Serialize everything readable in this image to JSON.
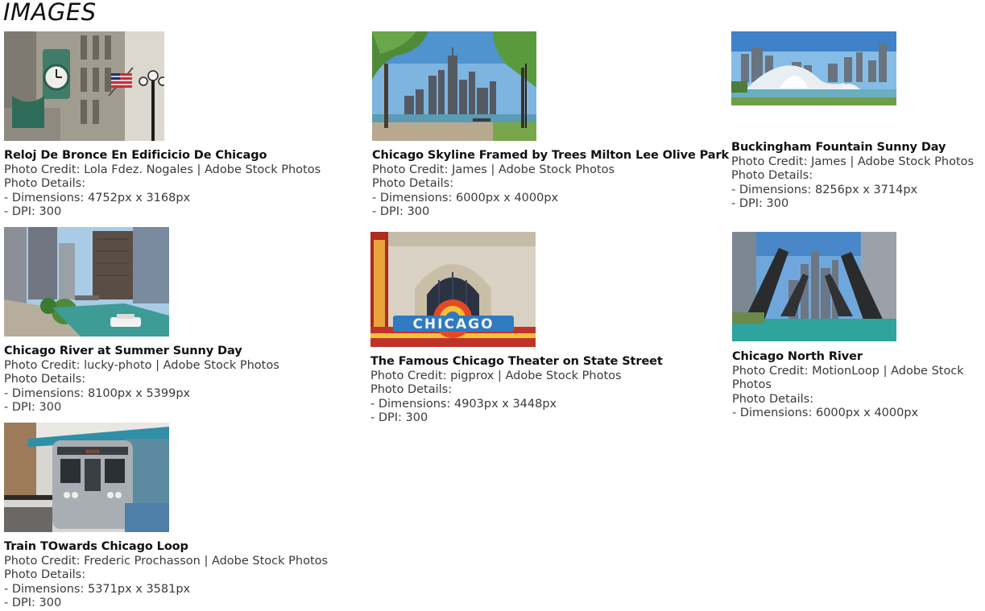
{
  "heading": "IMAGES",
  "images": [
    {
      "title": "Reloj De Bronce En Edificicio De Chicago",
      "credit": "Photo Credit: Lola Fdez. Nogales | Adobe Stock Photos",
      "details_label": "Photo Details:",
      "dimensions": "- Dimensions: 4752px x 3168px",
      "dpi": "- DPI: 300",
      "thumb_icon": "bronze-clock-building-photo"
    },
    {
      "title": "Chicago Skyline Framed by Trees Milton Lee Olive Park",
      "credit": "Photo Credit: James | Adobe Stock Photos",
      "details_label": "Photo Details:",
      "dimensions": "- Dimensions: 6000px x 4000px",
      "dpi": "- DPI: 300",
      "thumb_icon": "skyline-trees-photo"
    },
    {
      "title": "Buckingham Fountain Sunny Day",
      "credit": "Photo Credit: James | Adobe Stock Photos",
      "details_label": "Photo Details:",
      "dimensions": "- Dimensions: 8256px x 3714px",
      "dpi": "- DPI: 300",
      "thumb_icon": "fountain-photo"
    },
    {
      "title": "Chicago River at Summer Sunny Day",
      "credit": "Photo Credit: lucky-photo | Adobe Stock Photos",
      "details_label": "Photo Details:",
      "dimensions": "- Dimensions: 8100px x 5399px",
      "dpi": "- DPI: 300",
      "thumb_icon": "river-boat-photo"
    },
    {
      "title": "The Famous Chicago Theater on State Street",
      "credit": "Photo Credit: pigprox | Adobe Stock Photos",
      "details_label": "Photo Details:",
      "dimensions": "- Dimensions: 4903px x 3448px",
      "dpi": "- DPI: 300",
      "thumb_icon": "chicago-theater-sign-photo"
    },
    {
      "title": "Chicago North River",
      "credit": "Photo Credit: MotionLoop | Adobe Stock Photos",
      "details_label": "Photo Details:",
      "dimensions": "- Dimensions: 6000px x 4000px",
      "thumb_icon": "raised-bridges-photo"
    },
    {
      "title": "Train TOwards Chicago Loop",
      "credit": "Photo Credit: Frederic Prochasson | Adobe Stock Photos",
      "details_label": "Photo Details:",
      "dimensions": "- Dimensions: 5371px x 3581px",
      "dpi": "- DPI: 300",
      "thumb_icon": "l-train-photo"
    }
  ]
}
